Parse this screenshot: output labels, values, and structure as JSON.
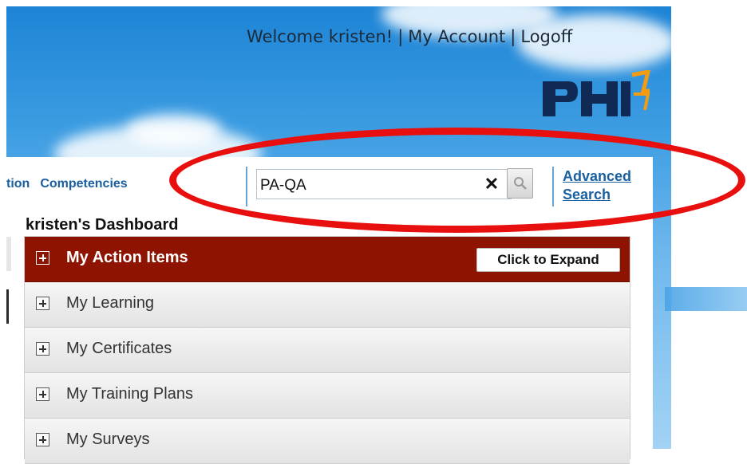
{
  "header": {
    "welcome": "Welcome kristen!",
    "separator": "|",
    "my_account": "My Account",
    "logoff": "Logoff"
  },
  "nav": {
    "items": [
      "tion",
      "Competencies"
    ]
  },
  "search": {
    "value": "PA-QA",
    "clear_symbol": "✕",
    "advanced_line1": "Advanced",
    "advanced_line2": "Search"
  },
  "dashboard": {
    "title": "kristen's Dashboard",
    "expand_label": "Click to Expand",
    "sections": [
      {
        "label": "My Action Items"
      },
      {
        "label": "My Learning"
      },
      {
        "label": "My Certificates"
      },
      {
        "label": "My Training Plans"
      },
      {
        "label": "My Surveys"
      }
    ]
  },
  "colors": {
    "active_header": "#8e1300",
    "link": "#1a5fa0",
    "highlight_ring": "#e8100f"
  }
}
